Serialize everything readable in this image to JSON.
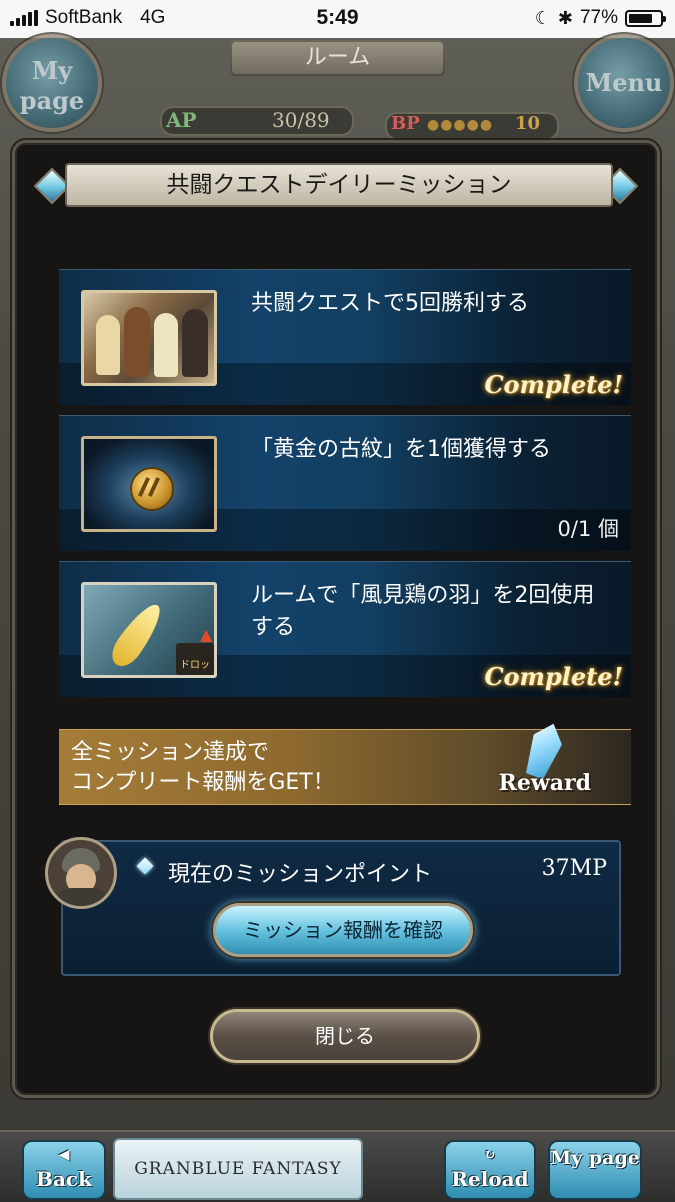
{
  "status_bar": {
    "carrier": "SoftBank",
    "network": "4G",
    "time": "5:49",
    "battery": "77%",
    "battery_level": 0.77
  },
  "game_header": {
    "title": "ルーム",
    "left_button": "My page",
    "right_button": "Menu",
    "ap_label": "AP",
    "ap_value": "30/89",
    "bp_label": "BP",
    "bp_value": "10"
  },
  "modal": {
    "title": "共闘クエストデイリーミッション",
    "missions": [
      {
        "text": "共闘クエストで5回勝利する",
        "status": "Complete!"
      },
      {
        "text": "「黄金の古紋」を1個獲得する",
        "status": "0/1 個"
      },
      {
        "text": "ルームで「風見鶏の羽」を2回使用する",
        "status": "Complete!",
        "badge": "ドロップ"
      }
    ],
    "reward_banner": {
      "line1": "全ミッション達成で",
      "line2": "コンプリート報酬をGET！",
      "reward_label": "Reward"
    },
    "mission_points": {
      "label": "現在のミッションポイント",
      "value": "37MP",
      "confirm_button": "ミッション報酬を確認"
    },
    "close_button": "閉じる"
  },
  "bottom_bar": {
    "back": "Back",
    "logo": "GRANBLUE FANTASY",
    "reload": "Reload",
    "mypage": "My page"
  },
  "colors": {
    "accent_blue": "#68c3e0",
    "complete_gold": "#fff2c9"
  }
}
